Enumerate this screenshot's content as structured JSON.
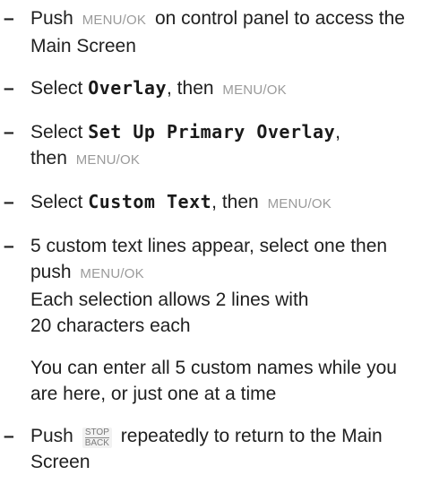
{
  "steps": [
    {
      "pre": "Push",
      "button": "MENU/OK",
      "post": "on control panel to access the Main Screen"
    },
    {
      "pre": "Select",
      "lcd": "Overlay",
      "mid": ", then",
      "button": "MENU/OK"
    },
    {
      "pre": "Select",
      "lcd": "Set Up Primary Overlay",
      "mid": ",",
      "post": "then",
      "button": "MENU/OK"
    },
    {
      "pre": "Select",
      "lcd": "Custom Text",
      "mid": ", then",
      "button": "MENU/OK"
    },
    {
      "pre": "5 custom text lines appear, select one then push",
      "button": "MENU/OK",
      "line2": "Each selection allows 2 lines with",
      "line3": "20 characters each",
      "note": "You can enter all 5 custom names while you are here, or just one at a time"
    },
    {
      "pre": "Push",
      "key_top": "STOP",
      "key_bottom": "BACK",
      "post": "repeatedly to return to the Main Screen"
    }
  ],
  "bullet": "–"
}
